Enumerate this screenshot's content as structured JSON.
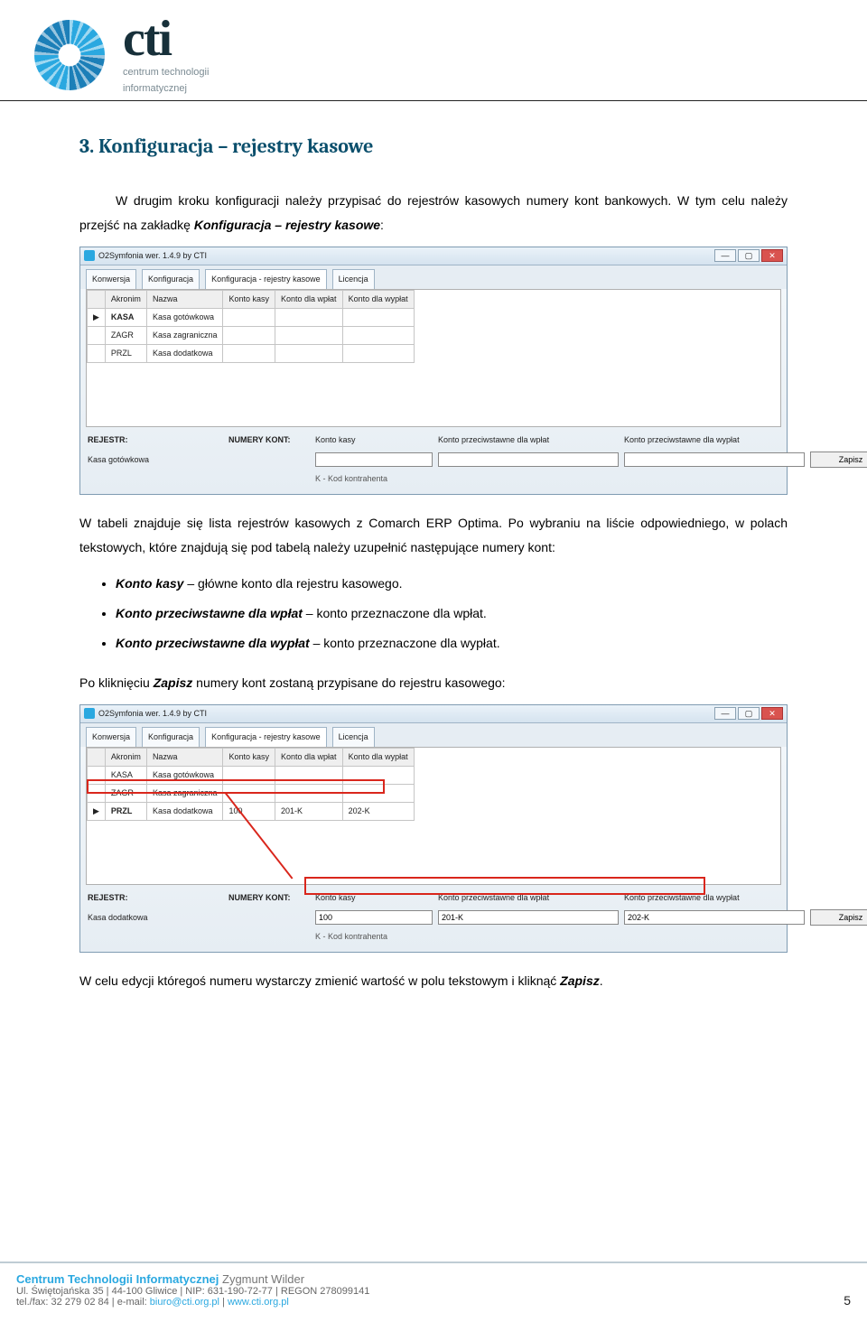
{
  "logo": {
    "cti": "cti",
    "sub1": "centrum technologii",
    "sub2": "informatycznej"
  },
  "heading": "3. Konfiguracja – rejestry kasowe",
  "p1a": "W drugim kroku konfiguracji należy przypisać do rejestrów kasowych numery kont bankowych. W tym celu należy przejść na zakładkę ",
  "p1b": "Konfiguracja – rejestry kasowe",
  "p1c": ":",
  "p2a": "W tabeli znajduje się lista rejestrów kasowych z Comarch ERP Optima. Po wybraniu na liście odpowiedniego, w polach tekstowych, które znajdują się pod tabelą należy uzupełnić następujące numery kont:",
  "bullets": [
    {
      "b": "Konto kasy",
      "t": " – główne konto dla rejestru kasowego."
    },
    {
      "b": "Konto przeciwstawne dla wpłat",
      "t": " – konto przeznaczone dla wpłat."
    },
    {
      "b": "Konto przeciwstawne dla wypłat",
      "t": " – konto przeznaczone dla wypłat."
    }
  ],
  "p3a": "Po kliknięciu ",
  "p3b": "Zapisz",
  "p3c": " numery kont zostaną przypisane do rejestru kasowego:",
  "p4a": "W celu edycji któregoś numeru wystarczy zmienić wartość w polu tekstowym i kliknąć ",
  "p4b": "Zapisz",
  "p4c": ".",
  "shot1": {
    "title": "O2Symfonia wer. 1.4.9 by CTI",
    "min": "—",
    "max": "▢",
    "close": "✕",
    "tabs": [
      "Konwersja",
      "Konfiguracja",
      "Konfiguracja - rejestry kasowe",
      "Licencja"
    ],
    "cols": [
      "",
      "Akronim",
      "Nazwa",
      "Konto kasy",
      "Konto dla wpłat",
      "Konto dla wypłat"
    ],
    "rows": [
      [
        "▶",
        "KASA",
        "Kasa gotówkowa",
        "",
        "",
        ""
      ],
      [
        "",
        "ZAGR",
        "Kasa zagraniczna",
        "",
        "",
        ""
      ],
      [
        "",
        "PRZL",
        "Kasa dodatkowa",
        "",
        "",
        ""
      ]
    ],
    "rejLabel": "REJESTR:",
    "rejVal": "Kasa gotówkowa",
    "numLabel": "NUMERY KONT:",
    "col_k": "Konto kasy",
    "col_w": "Konto przeciwstawne dla wpłat",
    "col_y": "Konto przeciwstawne dla wypłat",
    "v_k": "",
    "v_w": "",
    "v_y": "",
    "zapisz": "Zapisz",
    "kline": "K - Kod kontrahenta"
  },
  "shot2": {
    "title": "O2Symfonia wer. 1.4.9 by CTI",
    "min": "—",
    "max": "▢",
    "close": "✕",
    "tabs": [
      "Konwersja",
      "Konfiguracja",
      "Konfiguracja - rejestry kasowe",
      "Licencja"
    ],
    "cols": [
      "",
      "Akronim",
      "Nazwa",
      "Konto kasy",
      "Konto dla wpłat",
      "Konto dla wypłat"
    ],
    "rows": [
      [
        "",
        "KASA",
        "Kasa gotówkowa",
        "",
        "",
        ""
      ],
      [
        "",
        "ZAGR",
        "Kasa zagraniczna",
        "",
        "",
        ""
      ],
      [
        "▶",
        "PRZL",
        "Kasa dodatkowa",
        "100",
        "201-K",
        "202-K"
      ]
    ],
    "rejLabel": "REJESTR:",
    "rejVal": "Kasa dodatkowa",
    "numLabel": "NUMERY KONT:",
    "col_k": "Konto kasy",
    "col_w": "Konto przeciwstawne dla wpłat",
    "col_y": "Konto przeciwstawne dla wypłat",
    "v_k": "100",
    "v_w": "201-K",
    "v_y": "202-K",
    "zapisz": "Zapisz",
    "kline": "K - Kod kontrahenta"
  },
  "footer": {
    "name": "Centrum Technologii Informatycznej",
    "person": " Zygmunt Wilder",
    "line2": "Ul. Świętojańska 35  |  44-100 Gliwice  |  NIP: 631-190-72-77  |  REGON 278099141",
    "line3a": "tel./fax: 32 279 02 84  |  e-mail: ",
    "email": "biuro@cti.org.pl",
    "line3b": "  |  ",
    "url": "www.cti.org.pl",
    "page": "5"
  }
}
